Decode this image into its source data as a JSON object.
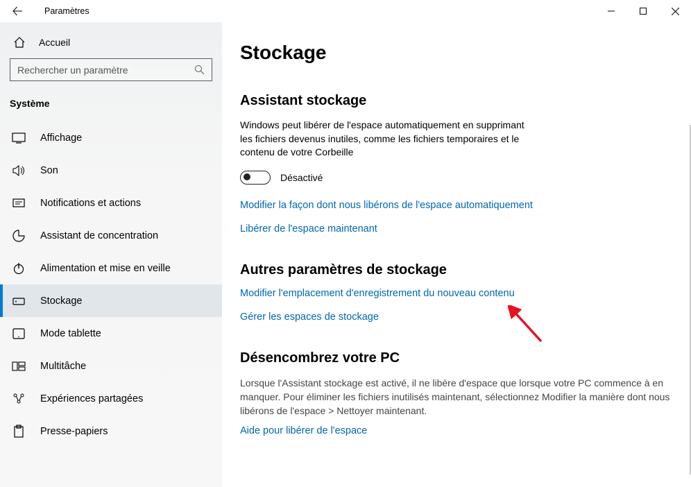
{
  "window": {
    "title": "Paramètres"
  },
  "sidebar": {
    "home_label": "Accueil",
    "search_placeholder": "Rechercher un paramètre",
    "group_title": "Système",
    "items": [
      {
        "id": "display",
        "label": "Affichage"
      },
      {
        "id": "sound",
        "label": "Son"
      },
      {
        "id": "notifications",
        "label": "Notifications et actions"
      },
      {
        "id": "focus",
        "label": "Assistant de concentration"
      },
      {
        "id": "power",
        "label": "Alimentation et mise en veille"
      },
      {
        "id": "storage",
        "label": "Stockage"
      },
      {
        "id": "tablet",
        "label": "Mode tablette"
      },
      {
        "id": "multitask",
        "label": "Multitâche"
      },
      {
        "id": "shared",
        "label": "Expériences partagées"
      },
      {
        "id": "clipboard",
        "label": "Presse-papiers"
      }
    ]
  },
  "content": {
    "page_title": "Stockage",
    "storage_sense": {
      "heading": "Assistant stockage",
      "description": "Windows peut libérer de l'espace automatiquement en supprimant les fichiers devenus inutiles, comme les fichiers temporaires et le contenu de votre Corbeille",
      "toggle_state_label": "Désactivé",
      "toggle_on": false,
      "link_change": "Modifier la façon dont nous libérons de l'espace automatiquement",
      "link_freenow": "Libérer de l'espace maintenant"
    },
    "more": {
      "heading": "Autres paramètres de stockage",
      "link_change_save_location": "Modifier l'emplacement d'enregistrement du nouveau contenu",
      "link_manage_spaces": "Gérer les espaces de stockage"
    },
    "declutter": {
      "heading": "Désencombrez votre PC",
      "description": "Lorsque l'Assistant stockage est activé, il ne libère d'espace que lorsque votre PC commence à en manquer. Pour éliminer les fichiers inutilisés maintenant, sélectionnez Modifier la manière dont nous libérons de l'espace > Nettoyer maintenant.",
      "link_help": "Aide pour libérer de l'espace"
    }
  }
}
